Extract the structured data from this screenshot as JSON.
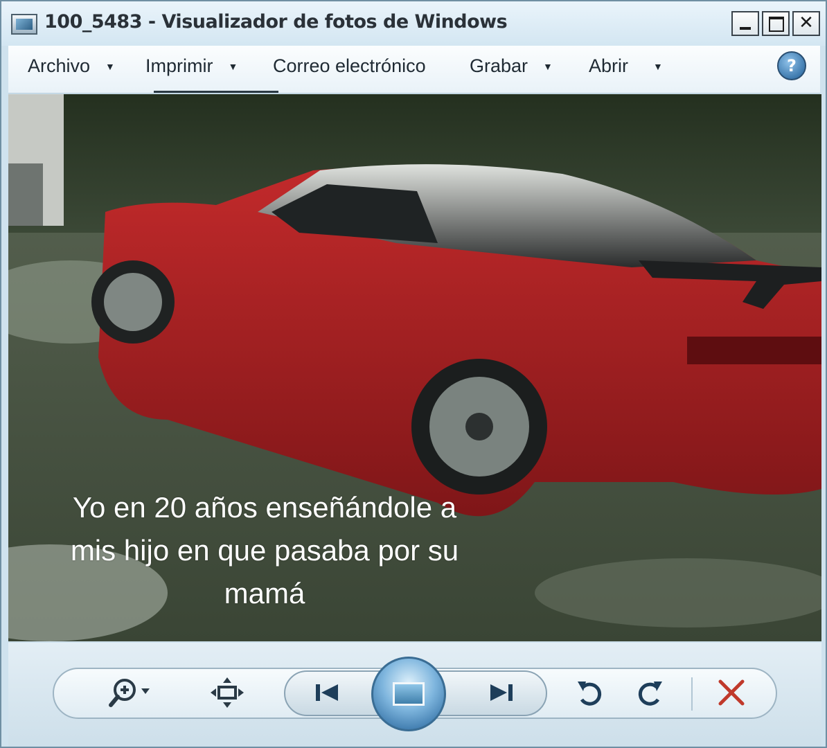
{
  "window": {
    "title": "100_5483 - Visualizador de fotos de Windows"
  },
  "menu": {
    "items": [
      {
        "label": "Archivo",
        "has_arrow": true
      },
      {
        "label": "Imprimir",
        "has_arrow": true
      },
      {
        "label": "Correo electrónico",
        "has_arrow": false
      },
      {
        "label": "Grabar",
        "has_arrow": true
      },
      {
        "label": "Abrir",
        "has_arrow": true
      }
    ],
    "arrow_glyph": "▼",
    "help_glyph": "?"
  },
  "photo": {
    "caption_line1": "Yo en 20 años enseñándole a",
    "caption_line2": "mis hijo en que pasaba por su",
    "caption_line3": "mamá",
    "car_color": "#b81f22"
  },
  "controls": {
    "zoom_icon": "zoom-icon",
    "fit_icon": "fit-to-window-icon",
    "previous_icon": "previous-icon",
    "slideshow_icon": "slideshow-icon",
    "next_icon": "next-icon",
    "rotate_ccw_icon": "rotate-counterclockwise-icon",
    "rotate_cw_icon": "rotate-clockwise-icon",
    "delete_icon": "delete-icon",
    "delete_color": "#c0392b"
  },
  "titlebar_buttons": {
    "close_glyph": "✕"
  }
}
